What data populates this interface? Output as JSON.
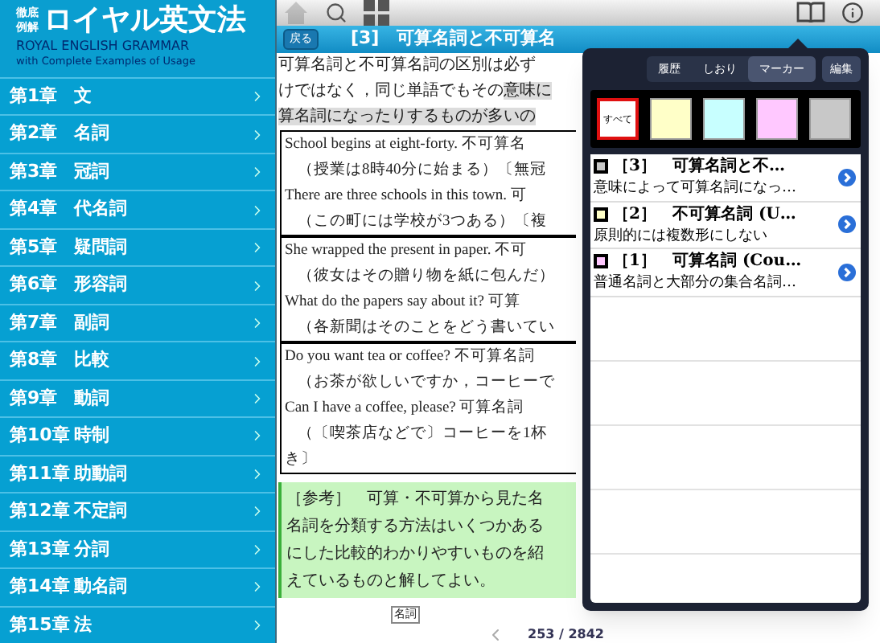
{
  "logo": {
    "badge": [
      "徹底",
      "例解"
    ],
    "title": "ロイヤル英文法",
    "subtitle": "ROYAL ENGLISH GRAMMAR",
    "tagline": "with Complete Examples of Usage"
  },
  "chapters": [
    {
      "number": "第1章",
      "name": "文"
    },
    {
      "number": "第2章",
      "name": "名詞"
    },
    {
      "number": "第3章",
      "name": "冠詞"
    },
    {
      "number": "第4章",
      "name": "代名詞"
    },
    {
      "number": "第5章",
      "name": "疑問詞"
    },
    {
      "number": "第6章",
      "name": "形容詞"
    },
    {
      "number": "第7章",
      "name": "副詞"
    },
    {
      "number": "第8章",
      "name": "比較"
    },
    {
      "number": "第9章",
      "name": "動詞"
    },
    {
      "number": "第10章",
      "name": "時制"
    },
    {
      "number": "第11章",
      "name": "助動詞"
    },
    {
      "number": "第12章",
      "name": "不定詞"
    },
    {
      "number": "第13章",
      "name": "分詞"
    },
    {
      "number": "第14章",
      "name": "動名詞"
    },
    {
      "number": "第15章",
      "name": "法"
    }
  ],
  "toolbar": {
    "home_disabled": true
  },
  "header": {
    "back": "戻る",
    "title": "[3]　可算名詞と不可算名"
  },
  "body": {
    "lines": [
      [
        {
          "text": "可算名詞と不可算名詞の区別は必ず",
          "marked": false
        }
      ],
      [
        {
          "text": "けではなく，同じ単語でもその",
          "marked": false
        },
        {
          "text": "意味に",
          "marked": true
        }
      ],
      [
        {
          "text": "算名詞になったりするものが多いの",
          "marked": true
        }
      ]
    ],
    "examples": [
      [
        "School begins at eight-forty. 不可算名",
        "（授業は8時40分に始まる）〔無冠",
        "There are three schools in this town. 可",
        "（この町には学校が3つある）〔複"
      ],
      [
        "She wrapped the present in paper. 不可",
        "（彼女はその贈り物を紙に包んだ）",
        "What do the papers say about it? 可算",
        "（各新聞はそのことをどう書いてい"
      ],
      [
        "Do you want tea or coffee? 不可算名詞",
        "（お茶が欲しいですか，コーヒーで",
        "Can I have a coffee, please? 可算名詞",
        "（〔喫茶店などで〕コーヒーを1杯",
        "き〕"
      ]
    ],
    "note": [
      "［参考］　可算・不可算から見た名",
      "名詞を分類する方法はいくつかある",
      "にした比較的わかりやすいものを紹",
      "えているものと解してよい。"
    ],
    "figure_label": "名詞"
  },
  "pager": {
    "text": "253 / 2842"
  },
  "popover": {
    "tabs": [
      {
        "label": "履歴",
        "selected": false
      },
      {
        "label": "しおり",
        "selected": false
      },
      {
        "label": "マーカー",
        "selected": true
      }
    ],
    "edit": "編集",
    "swatches": [
      {
        "label": "すべて",
        "color": "#ffffff",
        "selected": true
      },
      {
        "color": "#ffffc8",
        "selected": false
      },
      {
        "color": "#c8ffff",
        "selected": false
      },
      {
        "color": "#ffc8ff",
        "selected": false
      },
      {
        "color": "#c8c8c8",
        "selected": false
      }
    ],
    "items": [
      {
        "color": "#c8c8c8",
        "title": "［3］　可算名詞と不…",
        "snippet": "意味によって可算名詞になっ…"
      },
      {
        "color": "#ffffc8",
        "title": "［2］　不可算名詞 (U…",
        "snippet": "原則的には複数形にしない"
      },
      {
        "color": "#ffc8ff",
        "title": "［1］　可算名詞 (Cou…",
        "snippet": "普通名詞と大部分の集合名詞…"
      }
    ]
  }
}
